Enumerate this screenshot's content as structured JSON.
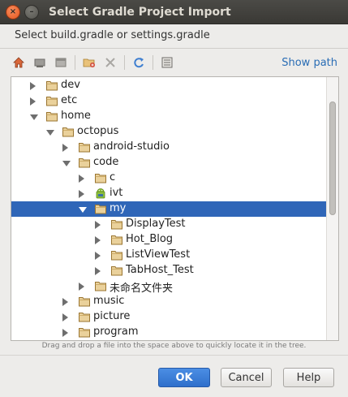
{
  "window": {
    "title": "Select Gradle Project Import",
    "close_glyph": "×",
    "minimize_glyph": "–"
  },
  "prompt": "Select build.gradle or settings.gradle",
  "toolbar": {
    "icons": [
      "home-icon",
      "desktop-icon",
      "project-icon",
      "new-folder-icon",
      "delete-icon",
      "refresh-icon",
      "show-hidden-icon"
    ],
    "show_path": "Show path"
  },
  "tree": {
    "items": [
      {
        "label": "dev",
        "state": "collapsed",
        "level": 0,
        "icon": "folder-icon"
      },
      {
        "label": "etc",
        "state": "collapsed",
        "level": 0,
        "icon": "folder-icon"
      },
      {
        "label": "home",
        "state": "expanded",
        "level": 0,
        "icon": "folder-icon"
      },
      {
        "label": "octopus",
        "state": "expanded",
        "level": 1,
        "icon": "folder-icon"
      },
      {
        "label": "android-studio",
        "state": "collapsed",
        "level": 2,
        "icon": "folder-icon"
      },
      {
        "label": "code",
        "state": "expanded",
        "level": 2,
        "icon": "folder-icon"
      },
      {
        "label": "c",
        "state": "collapsed",
        "level": 3,
        "icon": "folder-icon"
      },
      {
        "label": "ivt",
        "state": "collapsed",
        "level": 3,
        "icon": "android-icon"
      },
      {
        "label": "my",
        "state": "expanded",
        "level": 3,
        "icon": "folder-icon",
        "selected": true
      },
      {
        "label": "DisplayTest",
        "state": "collapsed",
        "level": 4,
        "icon": "folder-icon"
      },
      {
        "label": "Hot_Blog",
        "state": "collapsed",
        "level": 4,
        "icon": "folder-icon"
      },
      {
        "label": "ListViewTest",
        "state": "collapsed",
        "level": 4,
        "icon": "folder-icon"
      },
      {
        "label": "TabHost_Test",
        "state": "collapsed",
        "level": 4,
        "icon": "folder-icon"
      },
      {
        "label": "未命名文件夹",
        "state": "collapsed",
        "level": 3,
        "icon": "folder-icon"
      },
      {
        "label": "music",
        "state": "collapsed",
        "level": 2,
        "icon": "folder-icon"
      },
      {
        "label": "picture",
        "state": "collapsed",
        "level": 2,
        "icon": "folder-icon"
      },
      {
        "label": "program",
        "state": "collapsed",
        "level": 2,
        "icon": "folder-icon"
      }
    ]
  },
  "hint": "Drag and drop a file into the space above to quickly locate it in the tree.",
  "buttons": {
    "ok": "OK",
    "cancel": "Cancel",
    "help": "Help"
  },
  "colors": {
    "selection": "#2f66b8",
    "link": "#2a6db5",
    "ok_button": "#3a7bd5"
  }
}
